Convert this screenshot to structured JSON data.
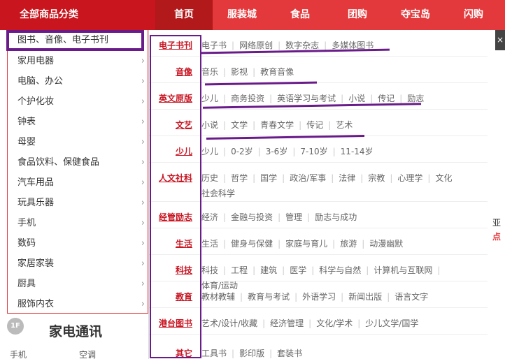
{
  "nav": {
    "all_categories": "全部商品分类",
    "items": [
      "首页",
      "服装城",
      "食品",
      "团购",
      "夺宝岛",
      "闪购"
    ]
  },
  "categories": [
    "图书、音像、电子书刊",
    "家用电器",
    "电脑、办公",
    "个护化妆",
    "钟表",
    "母婴",
    "食品饮料、保健食品",
    "汽车用品",
    "玩具乐器",
    "手机",
    "数码",
    "家居家装",
    "厨具",
    "服饰内衣"
  ],
  "panel": [
    {
      "title": "电子书刊",
      "links": [
        "电子书",
        "网络原创",
        "数字杂志",
        "多媒体图书"
      ]
    },
    {
      "title": "音像",
      "links": [
        "音乐",
        "影视",
        "教育音像"
      ]
    },
    {
      "title": "英文原版",
      "links": [
        "少儿",
        "商务投资",
        "英语学习与考试",
        "小说",
        "传记",
        "励志"
      ]
    },
    {
      "title": "文艺",
      "links": [
        "小说",
        "文学",
        "青春文学",
        "传记",
        "艺术"
      ]
    },
    {
      "title": "少儿",
      "links": [
        "少儿",
        "0-2岁",
        "3-6岁",
        "7-10岁",
        "11-14岁"
      ]
    },
    {
      "title": "人文社科",
      "links": [
        "历史",
        "哲学",
        "国学",
        "政治/军事",
        "法律",
        "宗教",
        "心理学",
        "文化",
        "社会科学"
      ]
    },
    {
      "title": "经管励志",
      "links": [
        "经济",
        "金融与投资",
        "管理",
        "励志与成功"
      ]
    },
    {
      "title": "生活",
      "links": [
        "生活",
        "健身与保健",
        "家庭与育儿",
        "旅游",
        "动漫幽默"
      ]
    },
    {
      "title": "科技",
      "links": [
        "科技",
        "工程",
        "建筑",
        "医学",
        "科学与自然",
        "计算机与互联网",
        "体育/运动"
      ]
    },
    {
      "title": "教育",
      "links": [
        "教材教辅",
        "教育与考试",
        "外语学习",
        "新闻出版",
        "语言文字"
      ]
    },
    {
      "title": "港台图书",
      "links": [
        "艺术/设计/收藏",
        "经济管理",
        "文化/学术",
        "少儿文学/国学"
      ]
    },
    {
      "title": "其它",
      "links": [
        "工具书",
        "影印版",
        "套装书"
      ]
    }
  ],
  "right_edge": {
    "close": "×",
    "text1": "亚",
    "text2": "点"
  },
  "floor": {
    "badge": "1F",
    "title": "家电通讯",
    "links": [
      "手机",
      "空调"
    ]
  },
  "colors": {
    "brand_red": "#e4393c",
    "highlight_purple": "#6a1b8a"
  }
}
